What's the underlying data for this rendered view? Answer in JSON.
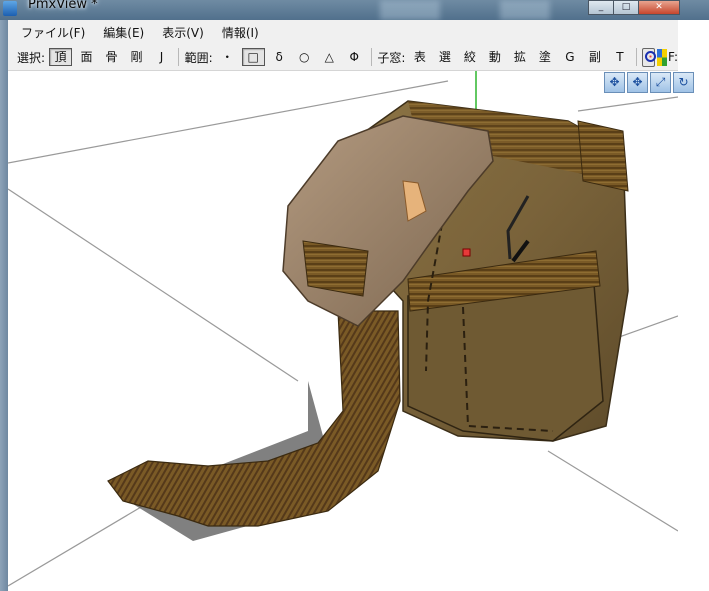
{
  "window": {
    "title": "PmxView *",
    "min_glyph": "_",
    "max_glyph": "□",
    "close_glyph": "✕"
  },
  "menu": [
    "ファイル(F)",
    "編集(E)",
    "表示(V)",
    "情報(I)"
  ],
  "toolbar": {
    "select_label": "選択:",
    "select_items": [
      "頂",
      "面",
      "骨",
      "剛",
      "J"
    ],
    "select_pressed": "頂",
    "range_label": "範囲:",
    "range_items": [
      "・",
      "□",
      "δ",
      "○",
      "△",
      "Φ"
    ],
    "range_pressed": "□",
    "child_label": "子窓:",
    "child_items": [
      "表",
      "選",
      "絞",
      "動",
      "拡",
      "塗",
      "G",
      "副",
      "T"
    ],
    "trailing_text": "F:"
  },
  "gizmo": {
    "icons": [
      "move-xz-icon",
      "move-xy-icon",
      "move-y-icon",
      "rotate-icon"
    ],
    "glyphs": [
      "✥",
      "✥",
      "⤢",
      "↻"
    ]
  }
}
